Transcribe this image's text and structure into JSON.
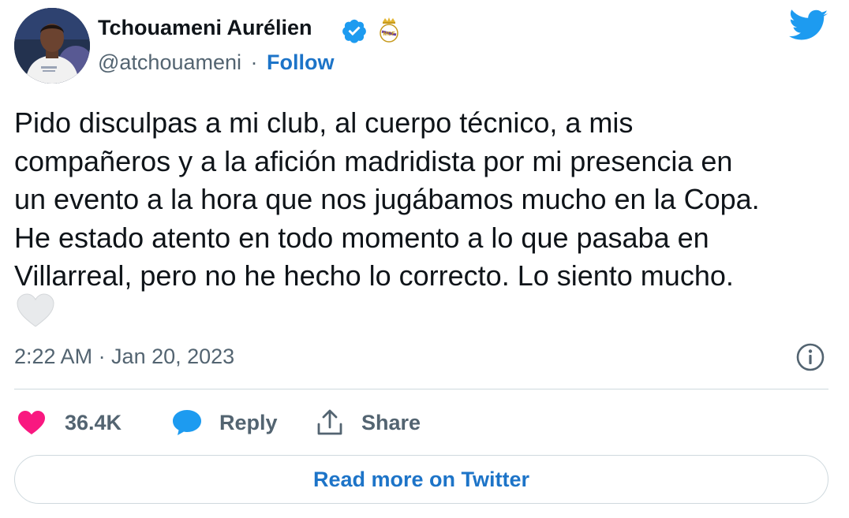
{
  "author": {
    "display_name": "Tchouameni Aurélien",
    "handle": "@atchouameni",
    "separator": "·",
    "follow_label": "Follow",
    "verified": true
  },
  "tweet": {
    "text": "Pido disculpas a mi club, al cuerpo técnico, a mis\ncompañeros y a la afición madridista por mi presencia en\nun evento a la hora que nos jugábamos mucho en la Copa.\nHe estado atento en todo momento a lo que pasaba en\nVillarreal, pero no he hecho lo correcto. Lo siento mucho.",
    "emoji": "white-heart",
    "timestamp": "2:22 AM · Jan 20, 2023"
  },
  "actions": {
    "likes_count": "36.4K",
    "reply_label": "Reply",
    "share_label": "Share"
  },
  "footer": {
    "read_more_label": "Read more on Twitter"
  },
  "colors": {
    "like_heart": "#f91880",
    "twitter_blue": "#1d9bf0",
    "link_blue": "#1d74c8",
    "muted_text": "#536471",
    "divider": "#cfd9de"
  },
  "icons": [
    "verified-badge-icon",
    "real-madrid-crest-icon",
    "twitter-bird-icon",
    "white-heart-icon",
    "info-icon",
    "heart-icon",
    "reply-bubble-icon",
    "share-icon"
  ]
}
